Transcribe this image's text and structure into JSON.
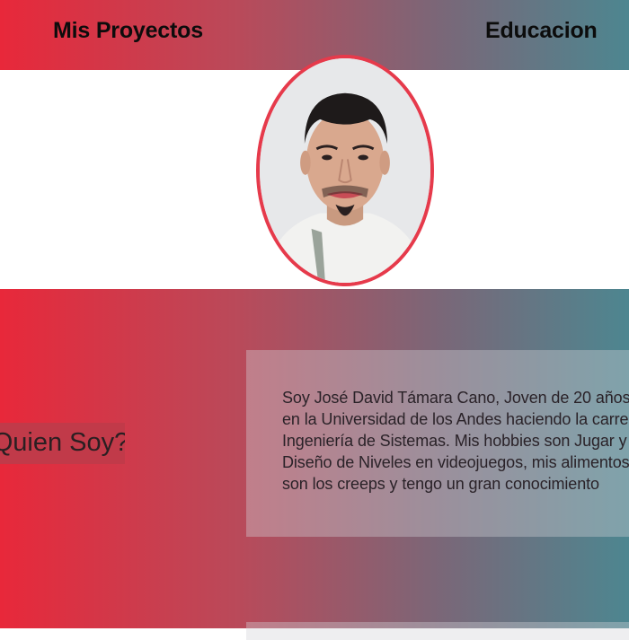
{
  "nav": {
    "projects_label": "Mis Proyectos",
    "education_label": "Educacion"
  },
  "about": {
    "title": "¿Quien Soy?",
    "lines": [
      "Soy José David Támara Cano, Joven de 20 años",
      "en la Universidad de los Andes haciendo la carrera de",
      "Ingeniería de Sistemas. Mis hobbies son Jugar y el",
      "Diseño de Niveles en videojuegos, mis alimentos favoritos",
      "son los creeps y tengo un gran conocimiento"
    ]
  },
  "colors": {
    "gradient_start": "#e8283a",
    "gradient_end": "#4d8690",
    "avatar_border": "#e63a4b"
  }
}
